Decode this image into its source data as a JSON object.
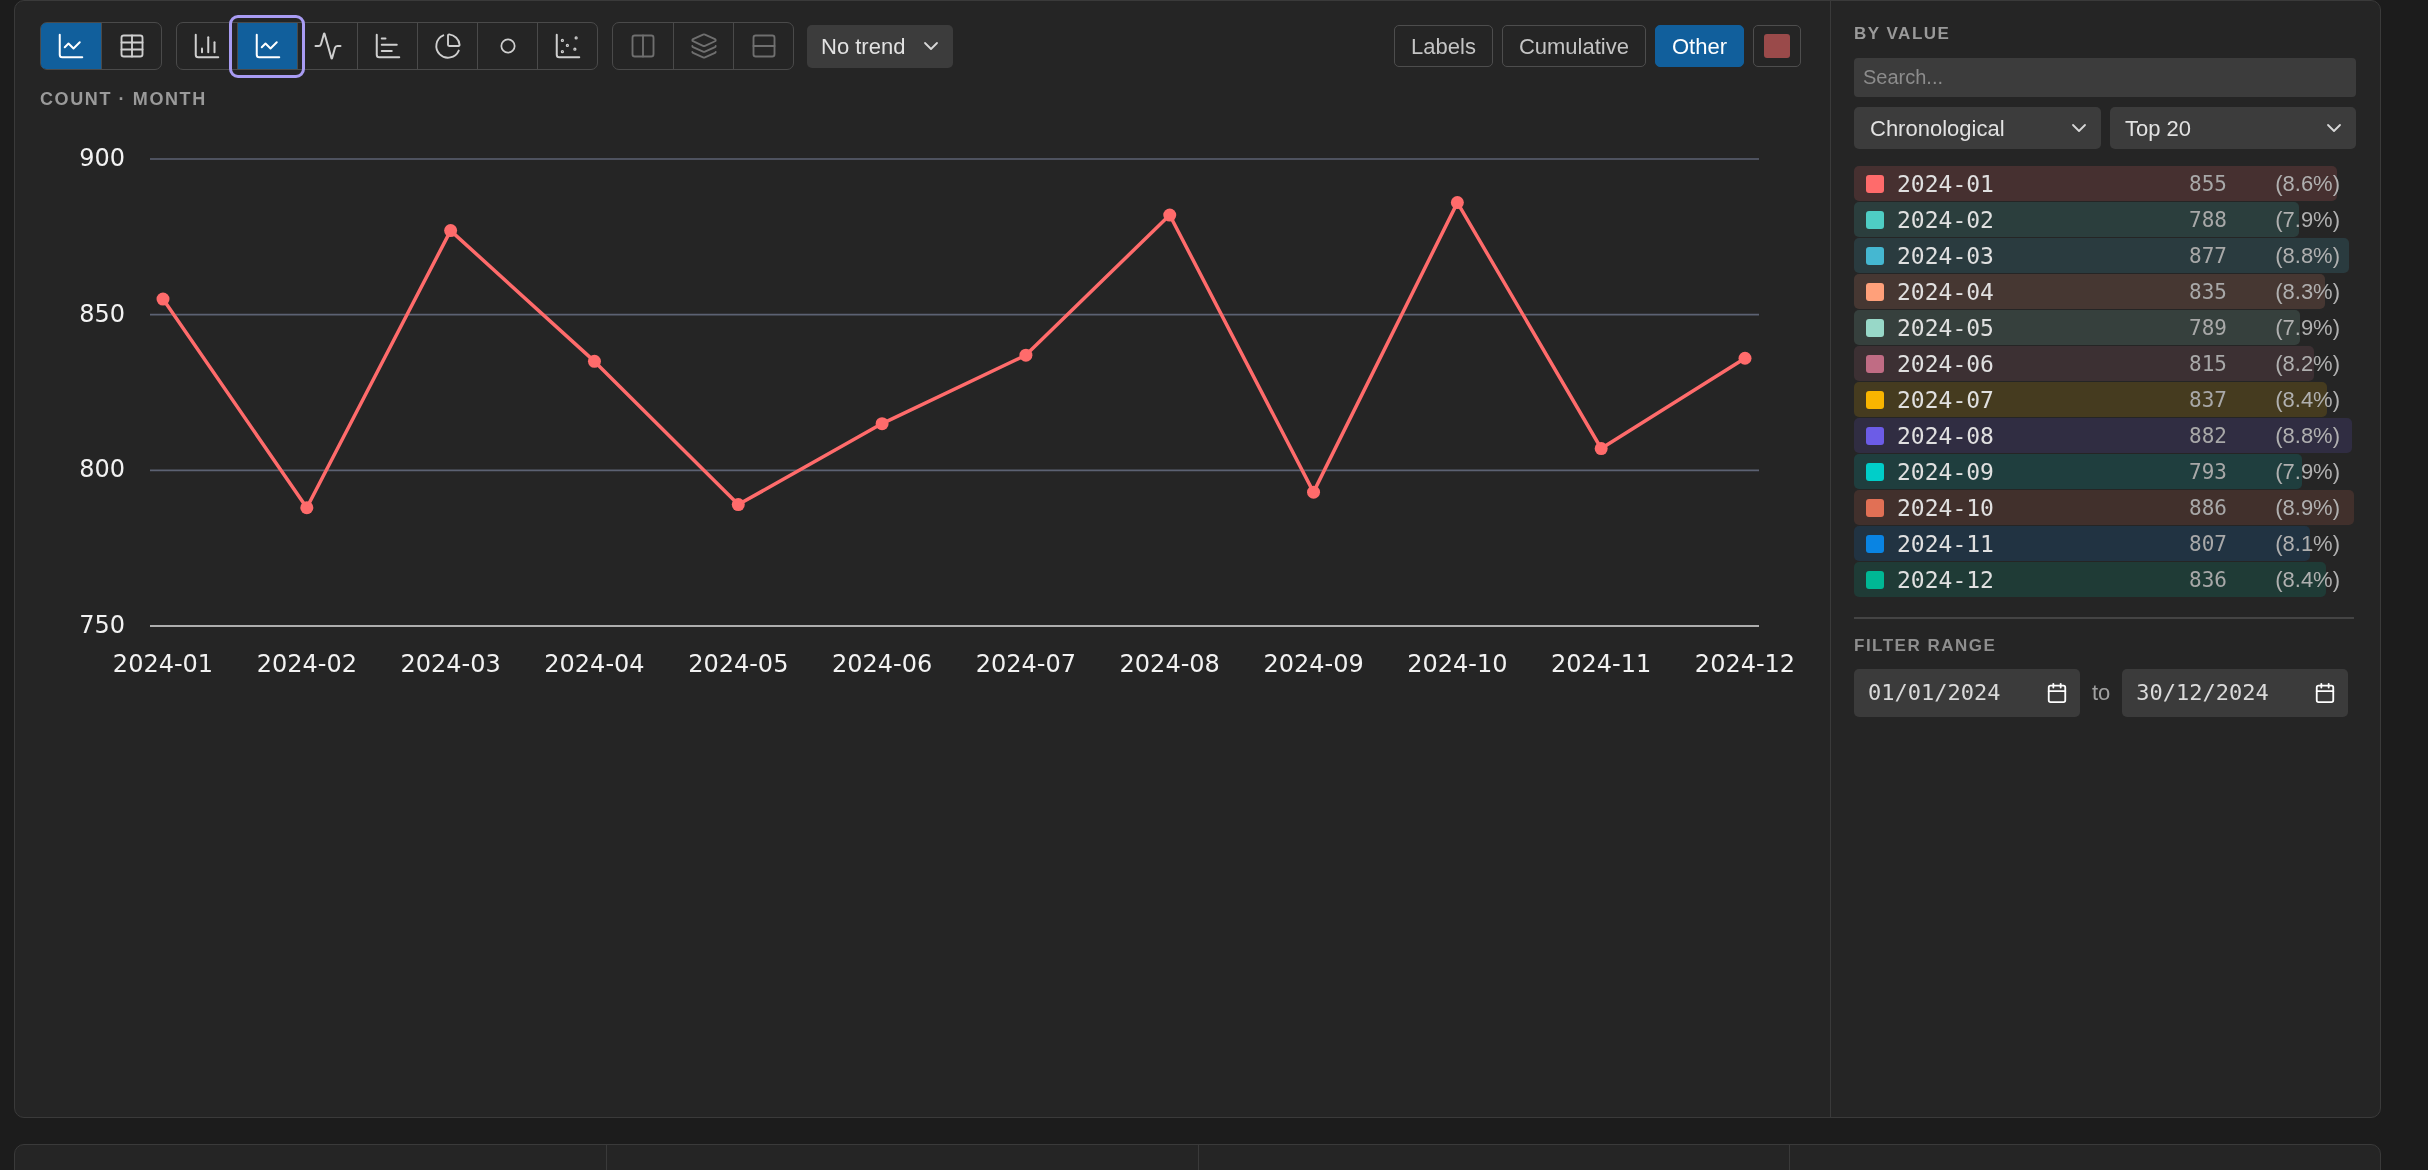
{
  "toolbar": {
    "view_modes": [
      {
        "kind": "chart",
        "selected": true
      },
      {
        "kind": "table",
        "selected": false
      }
    ],
    "chart_types": [
      {
        "kind": "bar",
        "selected": false,
        "focused": false
      },
      {
        "kind": "line",
        "selected": true,
        "focused": true
      },
      {
        "kind": "pulse",
        "selected": false,
        "focused": false
      },
      {
        "kind": "horizontal_bar",
        "selected": false,
        "focused": false
      },
      {
        "kind": "pie",
        "selected": false,
        "focused": false
      },
      {
        "kind": "dot",
        "selected": false,
        "focused": false
      },
      {
        "kind": "scatter",
        "selected": false,
        "focused": false
      }
    ],
    "layouts": [
      {
        "kind": "columns",
        "disabled": true
      },
      {
        "kind": "layers",
        "disabled": true
      },
      {
        "kind": "rows",
        "disabled": true
      }
    ],
    "trend_select": {
      "value": "No trend"
    },
    "options": [
      {
        "kind": "toggle",
        "label": "Labels",
        "on": false
      },
      {
        "kind": "toggle",
        "label": "Cumulative",
        "on": false
      },
      {
        "kind": "toggle",
        "label": "Other",
        "on": true
      },
      {
        "kind": "swatch",
        "color": "#9a4a4a"
      }
    ]
  },
  "chart": {
    "caption": "COUNT · MONTH",
    "chart_data": {
      "type": "line",
      "categories": [
        "2024-01",
        "2024-02",
        "2024-03",
        "2024-04",
        "2024-05",
        "2024-06",
        "2024-07",
        "2024-08",
        "2024-09",
        "2024-10",
        "2024-11",
        "2024-12"
      ],
      "series": [
        {
          "color": "#ff6b6b",
          "marker": "circle",
          "values": [
            855,
            788,
            877,
            835,
            789,
            815,
            837,
            882,
            793,
            886,
            807,
            836
          ]
        }
      ],
      "ylim": [
        750,
        900
      ],
      "yticks": [
        750,
        800,
        850,
        900
      ]
    }
  },
  "sidebar": {
    "heading": "BY VALUE",
    "search": {
      "placeholder": "Search..."
    },
    "sort_select": {
      "value": "Chronological"
    },
    "limit_select": {
      "value": "Top 20"
    },
    "items": [
      {
        "label": "2024-01",
        "value": "855",
        "percent": "(8.6%)",
        "level": 0.965,
        "color": "#ff6b6b"
      },
      {
        "label": "2024-02",
        "value": "788",
        "percent": "(7.9%)",
        "level": 0.889,
        "color": "#4ecdc4"
      },
      {
        "label": "2024-03",
        "value": "877",
        "percent": "(8.8%)",
        "level": 0.99,
        "color": "#45b7d1"
      },
      {
        "label": "2024-04",
        "value": "835",
        "percent": "(8.3%)",
        "level": 0.942,
        "color": "#ffa07a"
      },
      {
        "label": "2024-05",
        "value": "789",
        "percent": "(7.9%)",
        "level": 0.891,
        "color": "#98d8c8"
      },
      {
        "label": "2024-06",
        "value": "815",
        "percent": "(8.2%)",
        "level": 0.92,
        "color": "#c06c84"
      },
      {
        "label": "2024-07",
        "value": "837",
        "percent": "(8.4%)",
        "level": 0.945,
        "color": "#f8b500"
      },
      {
        "label": "2024-08",
        "value": "882",
        "percent": "(8.8%)",
        "level": 0.995,
        "color": "#6c5ce7"
      },
      {
        "label": "2024-09",
        "value": "793",
        "percent": "(7.9%)",
        "level": 0.895,
        "color": "#00cec9"
      },
      {
        "label": "2024-10",
        "value": "886",
        "percent": "(8.9%)",
        "level": 1,
        "color": "#e17055"
      },
      {
        "label": "2024-11",
        "value": "807",
        "percent": "(8.1%)",
        "level": 0.911,
        "color": "#0984e3"
      },
      {
        "label": "2024-12",
        "value": "836",
        "percent": "(8.4%)",
        "level": 0.944,
        "color": "#00b894"
      }
    ],
    "filter": {
      "heading": "FILTER RANGE",
      "from": "01/01/2024",
      "separator": "to",
      "to": "30/12/2024"
    }
  }
}
